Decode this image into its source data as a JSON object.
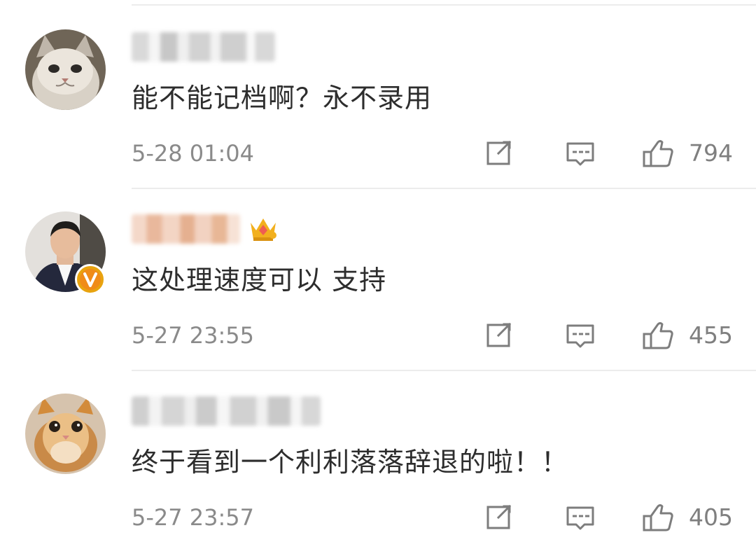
{
  "comments": [
    {
      "text": "能不能记档啊？永不录用",
      "time": "5-28 01:04",
      "likes": "794",
      "avatar_icon": "cat-avatar-gray",
      "verified_badge": false,
      "name_badge_icon": ""
    },
    {
      "text": "这处理速度可以 支持",
      "time": "5-27 23:55",
      "likes": "455",
      "avatar_icon": "man-suit-avatar",
      "verified_badge": true,
      "name_badge_icon": "crown-icon"
    },
    {
      "text": "终于看到一个利利落落辞退的啦！！",
      "time": "5-27 23:57",
      "likes": "405",
      "avatar_icon": "cat-avatar-orange",
      "verified_badge": false,
      "name_badge_icon": ""
    }
  ],
  "icons": {
    "share": "share-icon",
    "reply": "comment-icon",
    "like": "thumbs-up-icon",
    "verified": "verified-v-icon"
  },
  "colors": {
    "text": "#2d2d2d",
    "meta": "#8a8a8a",
    "divider": "#ececec",
    "verified_badge": "#e8a30f",
    "crown": "#f2b01e"
  }
}
